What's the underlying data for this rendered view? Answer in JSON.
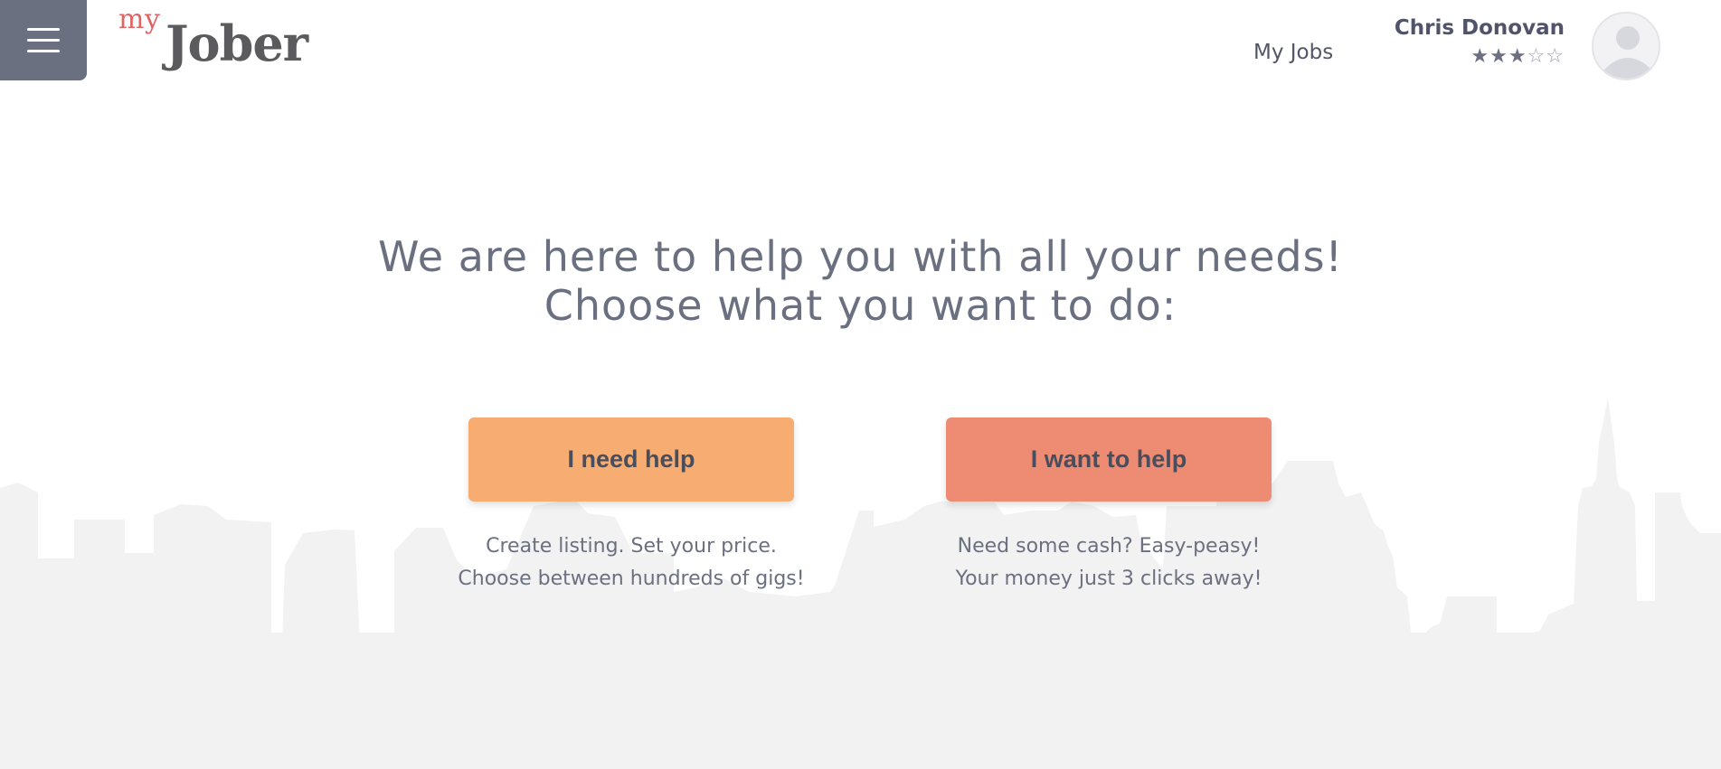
{
  "header": {
    "menu_icon": "hamburger-menu-icon",
    "logo": {
      "my": "my",
      "brand": "Jober"
    },
    "nav": {
      "my_jobs": "My Jobs"
    },
    "user": {
      "name": "Chris Donovan",
      "rating": 3,
      "rating_max": 5,
      "stars_filled": "★★★",
      "stars_empty": "☆☆",
      "avatar_icon": "user-avatar-icon"
    }
  },
  "hero": {
    "line1": "We are here to help you with all your needs!",
    "line2": "Choose what you want to do:"
  },
  "actions": {
    "need_help": {
      "label": "I need help",
      "desc_line1": "Create listing. Set your price.",
      "desc_line2": "Choose between hundreds of gigs!"
    },
    "want_help": {
      "label": "I want to help",
      "desc_line1": "Need some cash? Easy-peasy!",
      "desc_line2": "Your money just 3 clicks away!"
    }
  },
  "colors": {
    "header_menu": "#6b7080",
    "need_help_button": "#f7ad72",
    "want_help_button": "#ed8b73",
    "logo_accent": "#e06464",
    "skyline": "#f2f2f2"
  }
}
